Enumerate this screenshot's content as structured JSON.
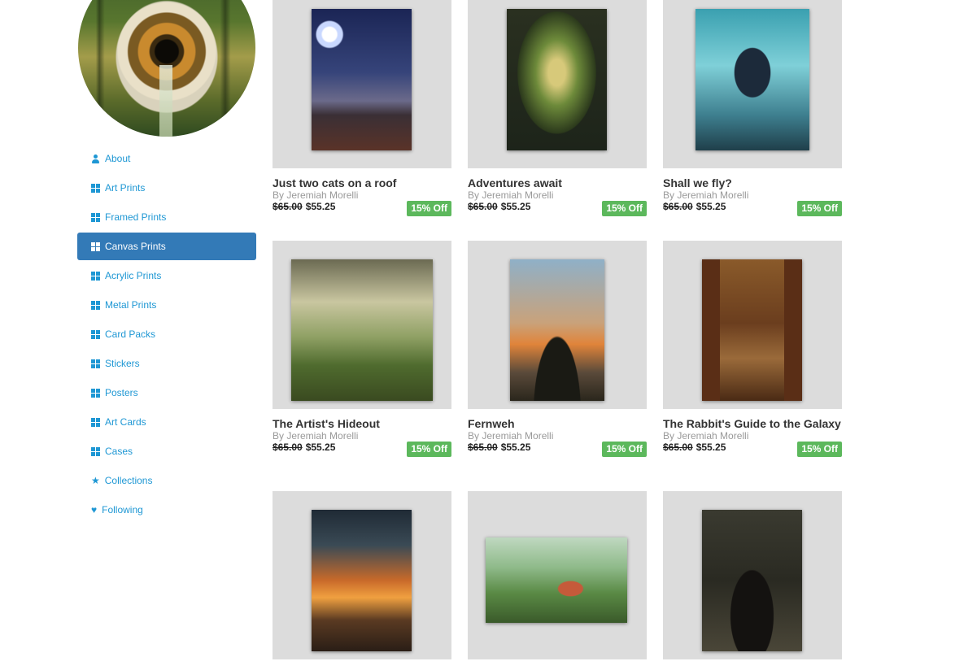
{
  "sidebar": {
    "items": [
      {
        "label": "About",
        "icon": "user-icon",
        "active": false
      },
      {
        "label": "Art Prints",
        "icon": "grid-icon",
        "active": false
      },
      {
        "label": "Framed Prints",
        "icon": "grid-icon",
        "active": false
      },
      {
        "label": "Canvas Prints",
        "icon": "grid-icon",
        "active": true
      },
      {
        "label": "Acrylic Prints",
        "icon": "grid-icon",
        "active": false
      },
      {
        "label": "Metal Prints",
        "icon": "grid-icon",
        "active": false
      },
      {
        "label": "Card Packs",
        "icon": "grid-icon",
        "active": false
      },
      {
        "label": "Stickers",
        "icon": "grid-icon",
        "active": false
      },
      {
        "label": "Posters",
        "icon": "grid-icon",
        "active": false
      },
      {
        "label": "Art Cards",
        "icon": "grid-icon",
        "active": false
      },
      {
        "label": "Cases",
        "icon": "grid-icon",
        "active": false
      },
      {
        "label": "Collections",
        "icon": "star-icon",
        "active": false
      },
      {
        "label": "Following",
        "icon": "heart-icon",
        "active": false
      }
    ]
  },
  "products": [
    {
      "title": "Just two cats on a roof",
      "artist": "By Jeremiah Morelli",
      "old_price": "$65.00",
      "price": "$55.25",
      "badge": "15% Off"
    },
    {
      "title": "Adventures await",
      "artist": "By Jeremiah Morelli",
      "old_price": "$65.00",
      "price": "$55.25",
      "badge": "15% Off"
    },
    {
      "title": "Shall we fly?",
      "artist": "By Jeremiah Morelli",
      "old_price": "$65.00",
      "price": "$55.25",
      "badge": "15% Off"
    },
    {
      "title": "The Artist's Hideout",
      "artist": "By Jeremiah Morelli",
      "old_price": "$65.00",
      "price": "$55.25",
      "badge": "15% Off"
    },
    {
      "title": "Fernweh",
      "artist": "By Jeremiah Morelli",
      "old_price": "$65.00",
      "price": "$55.25",
      "badge": "15% Off"
    },
    {
      "title": "The Rabbit's Guide to the Galaxy",
      "artist": "By Jeremiah Morelli",
      "old_price": "$65.00",
      "price": "$55.25",
      "badge": "15% Off"
    },
    {
      "title": "",
      "artist": "",
      "old_price": "",
      "price": "",
      "badge": ""
    },
    {
      "title": "",
      "artist": "",
      "old_price": "",
      "price": "",
      "badge": ""
    },
    {
      "title": "",
      "artist": "",
      "old_price": "",
      "price": "",
      "badge": ""
    }
  ],
  "colors": {
    "accent": "#1e97d4",
    "active_bg": "#337ab7",
    "badge_bg": "#5cb85c",
    "thumb_bg": "#dcdcdc"
  }
}
